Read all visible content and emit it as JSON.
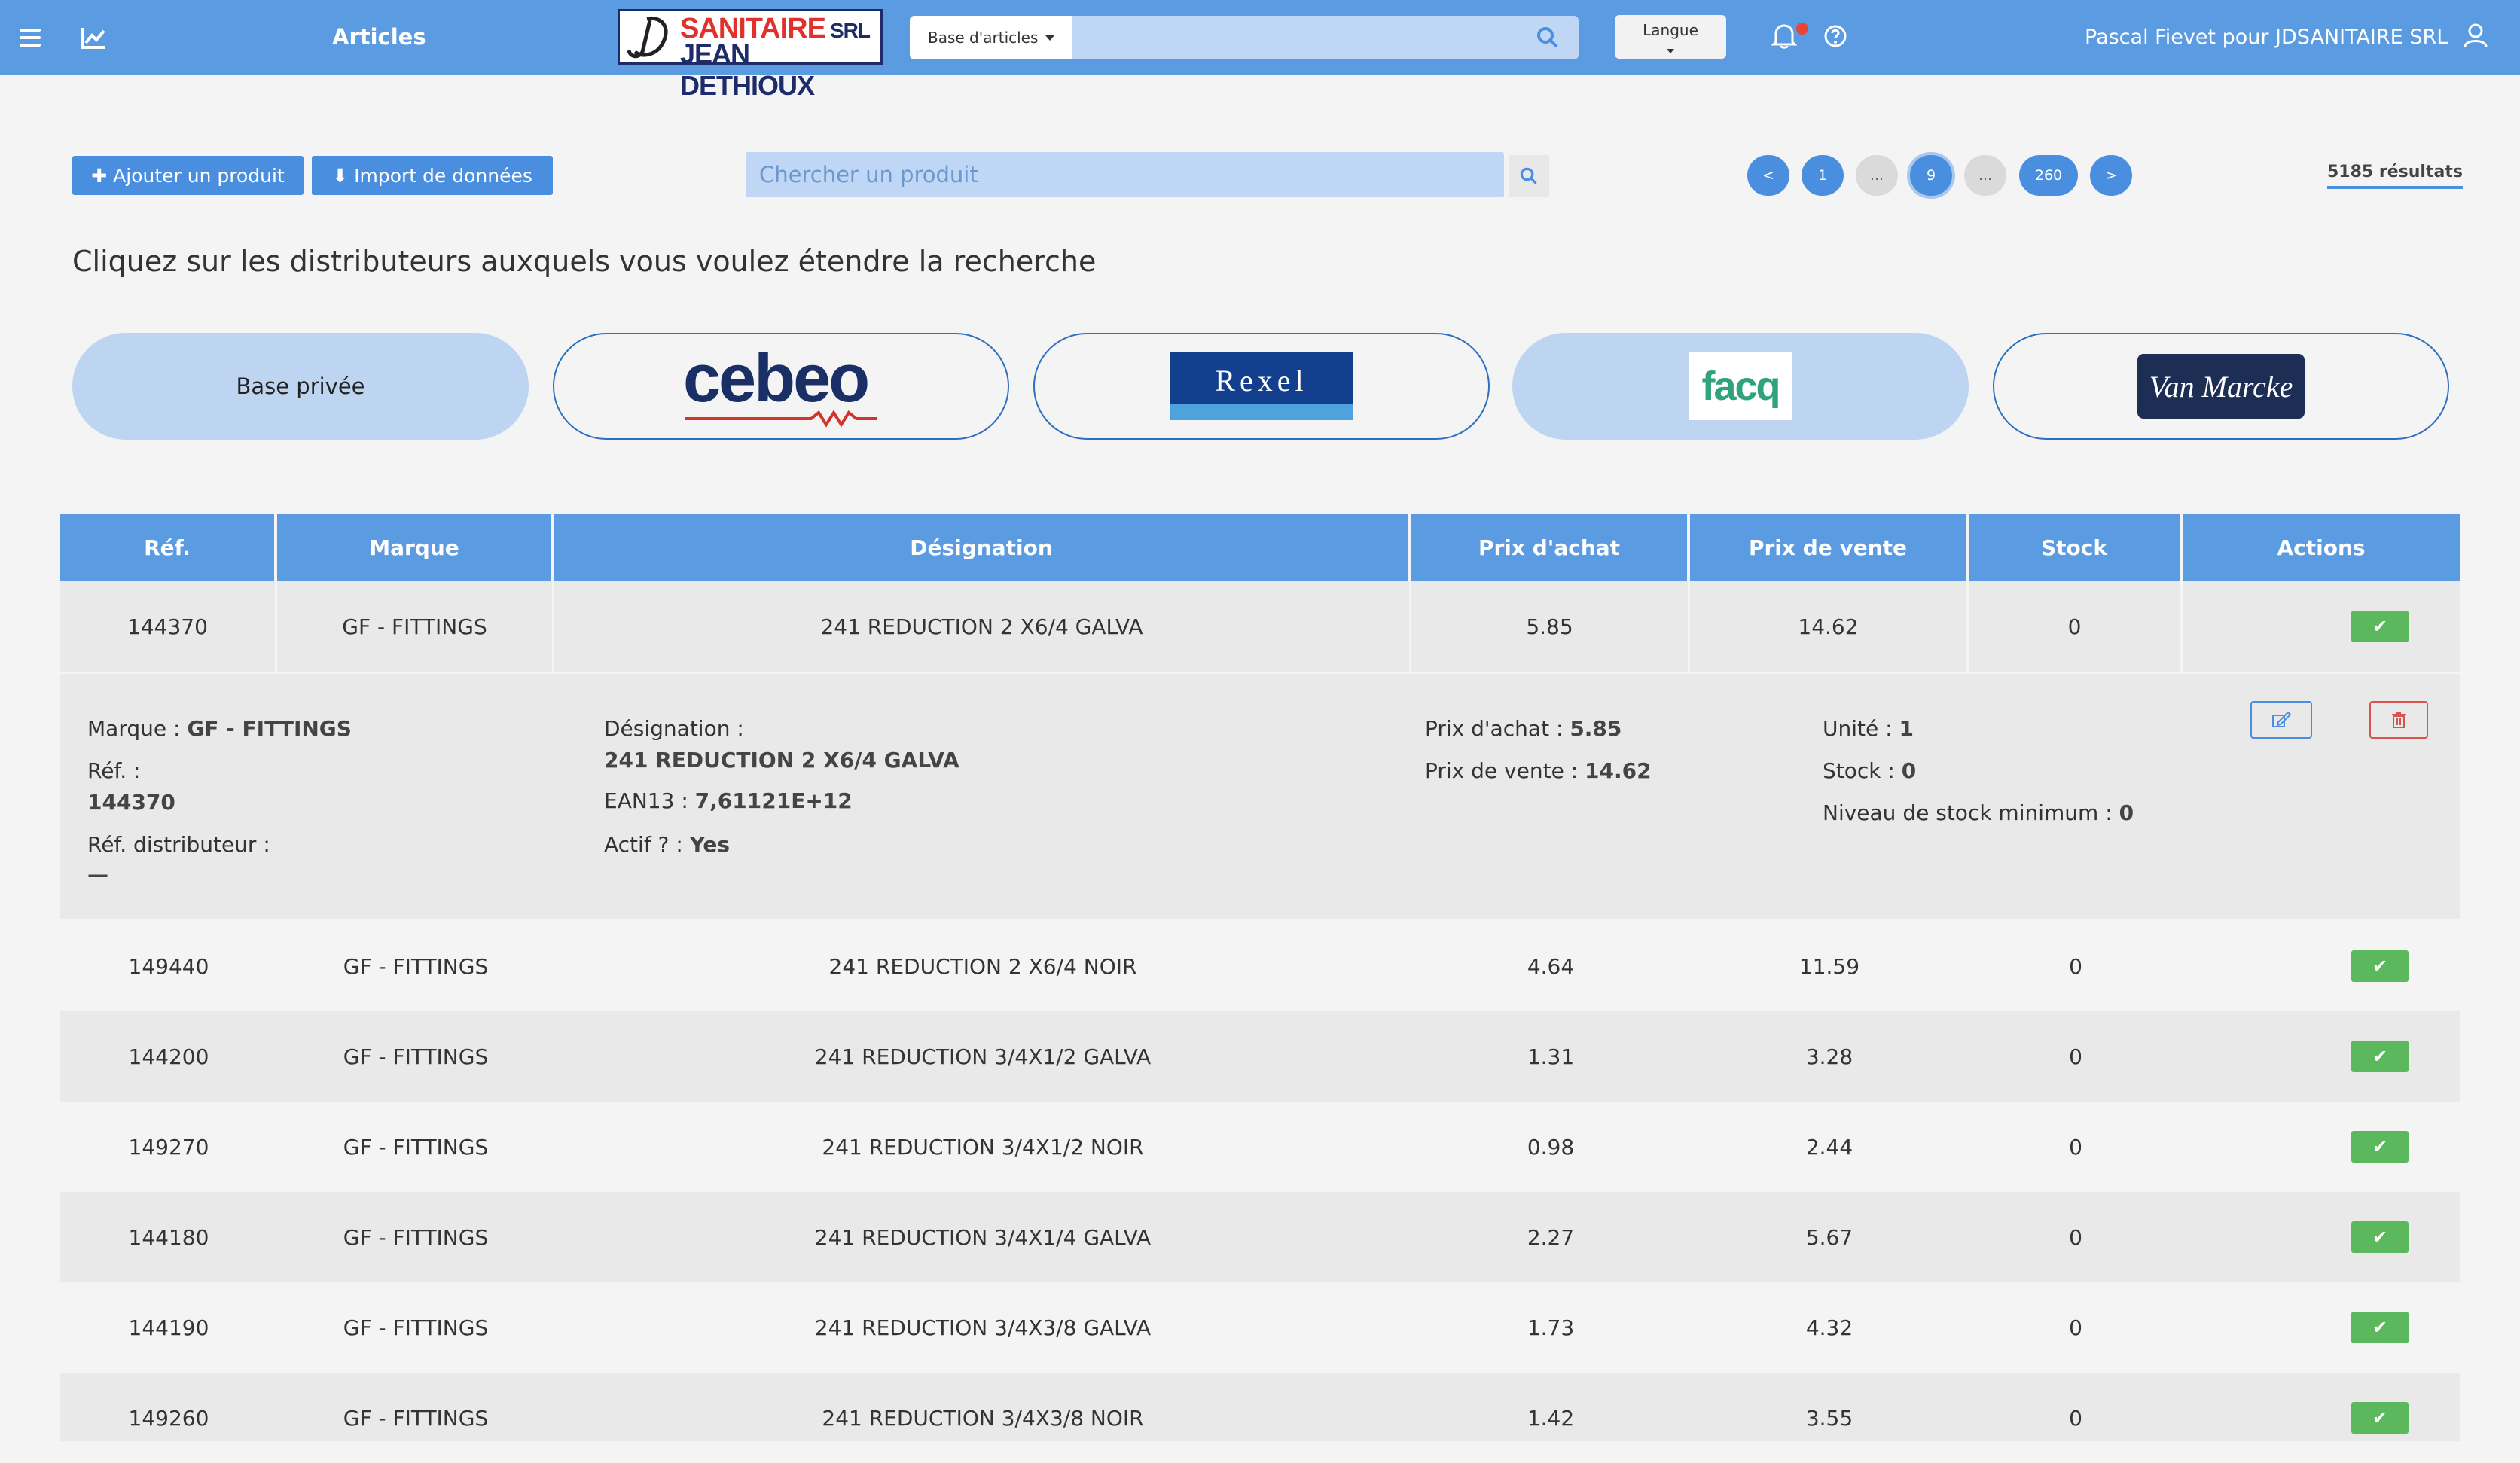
{
  "header": {
    "title": "Articles",
    "logo_line1": "SANITAIRE",
    "logo_line1_suffix": "SRL",
    "logo_line2": "JEAN DETHIOUX",
    "base_select": "Base d'articles",
    "search_value": "",
    "language_label": "Langue",
    "user": "Pascal Fievet pour JDSANITAIRE SRL"
  },
  "toolbar": {
    "add_product": "Ajouter un produit",
    "import_data": "Import de données",
    "search_placeholder": "Chercher un produit",
    "pagination": [
      "<",
      "1",
      "...",
      "9",
      "...",
      "260",
      ">"
    ],
    "current_page": "9",
    "results": "5185 résultats"
  },
  "instruction": "Cliquez sur les distributeurs auxquels vous voulez étendre la recherche",
  "distributors": [
    {
      "label": "Base privée",
      "selected": true
    },
    {
      "label": "cebeo",
      "selected": false
    },
    {
      "label": "Rexel",
      "selected": false
    },
    {
      "label": "facq",
      "selected": true
    },
    {
      "label": "Van Marcke",
      "selected": false
    }
  ],
  "table": {
    "columns": [
      "Réf.",
      "Marque",
      "Désignation",
      "Prix d'achat",
      "Prix de vente",
      "Stock",
      "Actions"
    ],
    "rows": [
      {
        "ref": "144370",
        "brand": "GF - FITTINGS",
        "designation": "241 REDUCTION 2 X6/4 GALVA",
        "purchase": "5.85",
        "sale": "14.62",
        "stock": "0"
      },
      {
        "ref": "149440",
        "brand": "GF - FITTINGS",
        "designation": "241 REDUCTION 2 X6/4 NOIR",
        "purchase": "4.64",
        "sale": "11.59",
        "stock": "0"
      },
      {
        "ref": "144200",
        "brand": "GF - FITTINGS",
        "designation": "241 REDUCTION 3/4X1/2 GALVA",
        "purchase": "1.31",
        "sale": "3.28",
        "stock": "0"
      },
      {
        "ref": "149270",
        "brand": "GF - FITTINGS",
        "designation": "241 REDUCTION 3/4X1/2 NOIR",
        "purchase": "0.98",
        "sale": "2.44",
        "stock": "0"
      },
      {
        "ref": "144180",
        "brand": "GF - FITTINGS",
        "designation": "241 REDUCTION 3/4X1/4 GALVA",
        "purchase": "2.27",
        "sale": "5.67",
        "stock": "0"
      },
      {
        "ref": "144190",
        "brand": "GF - FITTINGS",
        "designation": "241 REDUCTION 3/4X3/8 GALVA",
        "purchase": "1.73",
        "sale": "4.32",
        "stock": "0"
      },
      {
        "ref": "149260",
        "brand": "GF - FITTINGS",
        "designation": "241 REDUCTION 3/4X3/8 NOIR",
        "purchase": "1.42",
        "sale": "3.55",
        "stock": "0"
      }
    ],
    "detail": {
      "brand_label": "Marque :",
      "brand": "GF - FITTINGS",
      "ref_label": "Réf. :",
      "ref": "144370",
      "dist_ref_label": "Réf. distributeur :",
      "dist_ref": "—",
      "designation_label": "Désignation :",
      "designation": "241 REDUCTION 2 X6/4 GALVA",
      "ean_label": "EAN13 :",
      "ean": "7,61121E+12",
      "active_label": "Actif ? :",
      "active": "Yes",
      "purchase_label": "Prix d'achat :",
      "purchase": "5.85",
      "sale_label": "Prix de vente :",
      "sale": "14.62",
      "unit_label": "Unité :",
      "unit": "1",
      "stock_label": "Stock :",
      "stock": "0",
      "min_stock_label": "Niveau de stock minimum :",
      "min_stock": "0"
    }
  }
}
